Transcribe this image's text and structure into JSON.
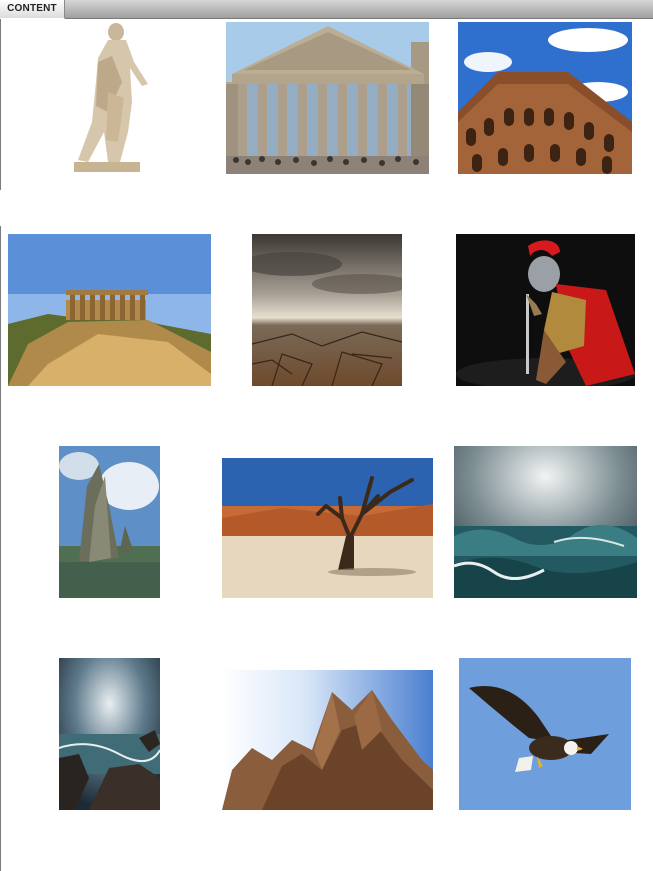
{
  "tab": {
    "label": "CONTENT"
  },
  "gallery": {
    "images": [
      "statue-of-caesar",
      "pantheon",
      "colosseum",
      "temple-on-hill",
      "cracked-desert-storm",
      "roman-soldier",
      "sea-stack-rock",
      "dead-tree-desert",
      "stormy-ocean-waves",
      "rocky-coast-storm",
      "mountain-peaks",
      "bald-eagle"
    ]
  }
}
